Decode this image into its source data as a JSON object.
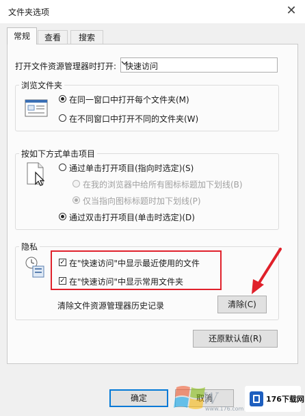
{
  "window": {
    "title": "文件夹选项",
    "close_glyph": "✕"
  },
  "tabs": [
    {
      "label": "常规"
    },
    {
      "label": "查看"
    },
    {
      "label": "搜索"
    }
  ],
  "open_in": {
    "label": "打开文件资源管理器时打开:",
    "value": "快速访问"
  },
  "browse_folders": {
    "title": "浏览文件夹",
    "options": [
      {
        "label": "在同一窗口中打开每个文件夹(M)",
        "selected": true
      },
      {
        "label": "在不同窗口中打开不同的文件夹(W)",
        "selected": false
      }
    ]
  },
  "click_items": {
    "title": "按如下方式单击项目",
    "options": [
      {
        "label": "通过单击打开项目(指向时选定)(S)",
        "selected": false
      },
      {
        "label": "在我的浏览器中给所有图标标题加下划线(B)",
        "selected": false,
        "disabled": true
      },
      {
        "label": "仅当指向图标标题时加下划线(P)",
        "selected": true,
        "disabled": true
      },
      {
        "label": "通过双击打开项目(单击时选定)(D)",
        "selected": true
      }
    ]
  },
  "privacy": {
    "title": "隐私",
    "checkboxes": [
      {
        "label": "在\"快速访问\"中显示最近使用的文件",
        "checked": true
      },
      {
        "label": "在\"快速访问\"中显示常用文件夹",
        "checked": true
      }
    ],
    "clear_history_label": "清除文件资源管理器历史记录",
    "clear_button": "清除(C)"
  },
  "restore_defaults_button": "还原默认值(R)",
  "footer": {
    "ok_button": "确定",
    "cancel_button": "取消"
  },
  "watermark": {
    "site": "176下载网",
    "domain": "www.176.com"
  },
  "colors": {
    "highlight": "#e0202a",
    "accent": "#0078d7"
  }
}
